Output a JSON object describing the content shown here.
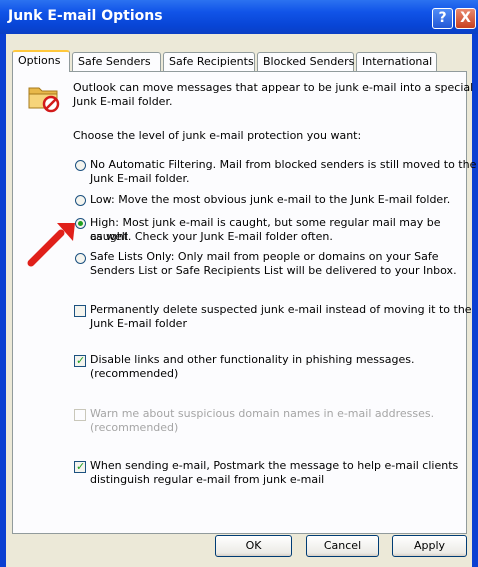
{
  "window": {
    "title": "Junk E-mail Options"
  },
  "titlebar_buttons": {
    "help": "?",
    "close": "X"
  },
  "tabs": [
    {
      "label": "Options",
      "active": true
    },
    {
      "label": "Safe Senders",
      "active": false
    },
    {
      "label": "Safe Recipients",
      "active": false
    },
    {
      "label": "Blocked Senders",
      "active": false
    },
    {
      "label": "International",
      "active": false
    }
  ],
  "options": {
    "intro": [
      "Outlook can move messages that appear to be junk e-mail into a special",
      "Junk E-mail folder."
    ],
    "choose_label": "Choose the level of junk e-mail protection you want:",
    "levels": [
      {
        "lines": [
          "No Automatic Filtering. Mail from blocked senders is still moved to the",
          "Junk E-mail folder."
        ],
        "selected": false
      },
      {
        "lines": [
          "Low: Move the most obvious junk e-mail to the Junk E-mail folder."
        ],
        "selected": false
      },
      {
        "lines": [
          "High: Most junk e-mail is caught, but some regular mail may be caught",
          "as well. Check your Junk E-mail folder often."
        ],
        "selected": true
      },
      {
        "lines": [
          "Safe Lists Only: Only mail from people or domains on your Safe",
          "Senders List or Safe Recipients List will be delivered to your Inbox."
        ],
        "selected": false
      }
    ],
    "checkboxes": [
      {
        "lines": [
          "Permanently delete suspected junk e-mail instead of moving it to the",
          "Junk E-mail folder"
        ],
        "checked": false,
        "enabled": true
      },
      {
        "lines": [
          "Disable links and other functionality in phishing messages.",
          "(recommended)"
        ],
        "checked": true,
        "enabled": true
      },
      {
        "lines": [
          "Warn me about suspicious domain names in e-mail addresses.",
          "(recommended)"
        ],
        "checked": false,
        "enabled": false
      },
      {
        "lines": [
          "When sending e-mail, Postmark the message to help e-mail clients",
          "distinguish regular e-mail from junk e-mail"
        ],
        "checked": true,
        "enabled": true
      }
    ]
  },
  "buttons": {
    "ok": "OK",
    "cancel": "Cancel",
    "apply": "Apply"
  },
  "icons": {
    "folder": "junk-folder-icon",
    "arrow": "red-arrow-annotation"
  },
  "colors": {
    "titlebar": "#0a3fd2",
    "dialog_bg": "#ece9d8",
    "radio_dot": "#21a121",
    "arrow": "#e0201a"
  }
}
